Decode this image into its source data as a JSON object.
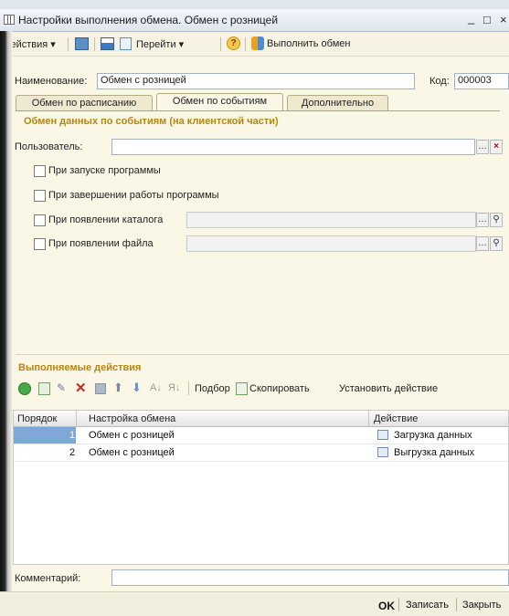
{
  "window": {
    "title": "Настройки выполнения обмена. Обмен с розницей",
    "minimize_glyph": "_",
    "maximize_glyph": "□",
    "close_glyph": "×"
  },
  "toolbar": {
    "actions_label": "Действия",
    "goto_label": "Перейти",
    "execute_label": "Выполнить обмен",
    "help_glyph": "?"
  },
  "form": {
    "name_label": "Наименование:",
    "name_value": "Обмен с розницей",
    "code_label": "Код:",
    "code_value": "000003"
  },
  "tabs": [
    {
      "label": "Обмен по расписанию",
      "active": false
    },
    {
      "label": "Обмен по событиям",
      "active": true
    },
    {
      "label": "Дополнительно",
      "active": false
    }
  ],
  "events_group": {
    "title": "Обмен данных по событиям (на клиентской части)",
    "user_label": "Пользователь:",
    "user_value": "",
    "checkboxes": [
      {
        "label": "При запуске программы",
        "checked": false
      },
      {
        "label": "При завершении работы программы",
        "checked": false
      },
      {
        "label": "При появлении каталога",
        "checked": false
      },
      {
        "label": "При появлении файла",
        "checked": false
      }
    ]
  },
  "actions": {
    "title": "Выполняемые действия",
    "selection_label": "Подбор",
    "copy_label": "Скопировать",
    "set_action_label": "Установить действие",
    "columns": [
      "Порядок",
      "Настройка обмена",
      "Действие"
    ],
    "rows": [
      {
        "order": "1",
        "setting": "Обмен с розницей",
        "action": "Загрузка данных"
      },
      {
        "order": "2",
        "setting": "Обмен с розницей",
        "action": "Выгрузка данных"
      }
    ]
  },
  "comment": {
    "label": "Комментарий:",
    "value": ""
  },
  "footer": {
    "ok_label": "OK",
    "save_label": "Записать",
    "close_label": "Закрыть"
  },
  "colors": {
    "form_bg": "#fbf7e6",
    "group_title": "#b8860b",
    "selected_row": "#7fa8d8",
    "input_border": "#9fb3c8"
  }
}
